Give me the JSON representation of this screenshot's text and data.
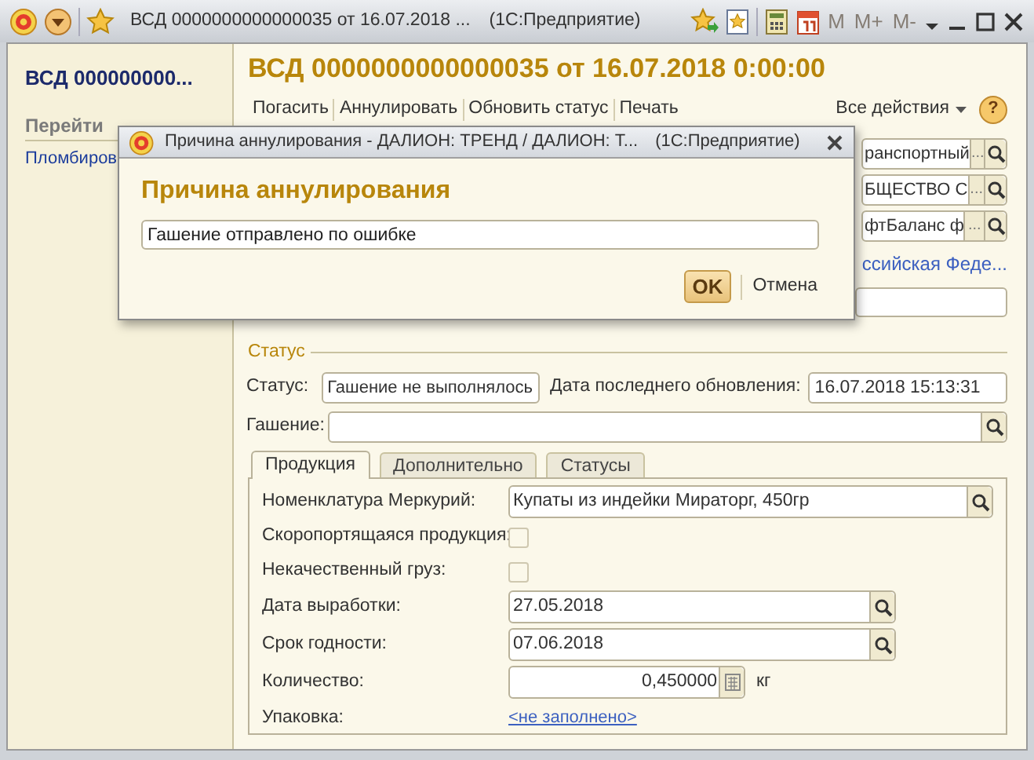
{
  "window": {
    "title": "ВСД 0000000000000035 от 16.07.2018 ...",
    "app": "(1С:Предприятие)",
    "memory_buttons": [
      "M",
      "M+",
      "M-"
    ]
  },
  "sidebar": {
    "title": "ВСД 000000000...",
    "section": "Перейти",
    "items": [
      {
        "label": "Пломбиров"
      }
    ]
  },
  "form": {
    "title": "ВСД 0000000000000035 от 16.07.2018 0:00:00",
    "commands": [
      "Погасить",
      "Аннулировать",
      "Обновить статус",
      "Печать"
    ],
    "all_actions": "Все действия",
    "help": "?",
    "hidden_fields": [
      {
        "value": "ранспортный",
        "button": "..."
      },
      {
        "value": "БЩЕСТВО С",
        "button": "..."
      },
      {
        "value": "фтБаланс ф",
        "button": "..."
      }
    ],
    "hidden_link": "ссийская Феде...",
    "status_group": {
      "legend": "Статус",
      "status_label": "Статус:",
      "status_value": "Гашение не выполнялось",
      "updated_label": "Дата последнего обновления:",
      "updated_value": "16.07.2018 15:13:31",
      "redemption_label": "Гашение:"
    },
    "tabs": [
      {
        "label": "Продукция",
        "selected": true
      },
      {
        "label": "Дополнительно",
        "selected": false
      },
      {
        "label": "Статусы",
        "selected": false
      }
    ],
    "rows": [
      {
        "kind": "lookup",
        "label": "Номенклатура Меркурий:",
        "value": "Купаты из индейки Мираторг, 450гр"
      },
      {
        "kind": "checkbox",
        "label": "Скоропортящаяся продукция:",
        "checked": false
      },
      {
        "kind": "checkbox",
        "label": "Некачественный груз:",
        "checked": false
      },
      {
        "kind": "date",
        "label": "Дата выработки:",
        "value": "27.05.2018"
      },
      {
        "kind": "date",
        "label": "Срок годности:",
        "value": "07.06.2018"
      },
      {
        "kind": "number",
        "label": "Количество:",
        "value": "0,450000",
        "unit": "кг"
      },
      {
        "kind": "link",
        "label": "Упаковка:",
        "value": "<не заполнено>"
      }
    ]
  },
  "dialog": {
    "title": "Причина аннулирования - ДАЛИОН: ТРЕНД / ДАЛИОН: Т...",
    "app": "(1С:Предприятие)",
    "heading": "Причина аннулирования",
    "value": "Гашение отправлено по ошибке",
    "buttons": [
      {
        "label": "OK",
        "default": true
      },
      {
        "label": "Отмена",
        "default": false
      }
    ]
  }
}
